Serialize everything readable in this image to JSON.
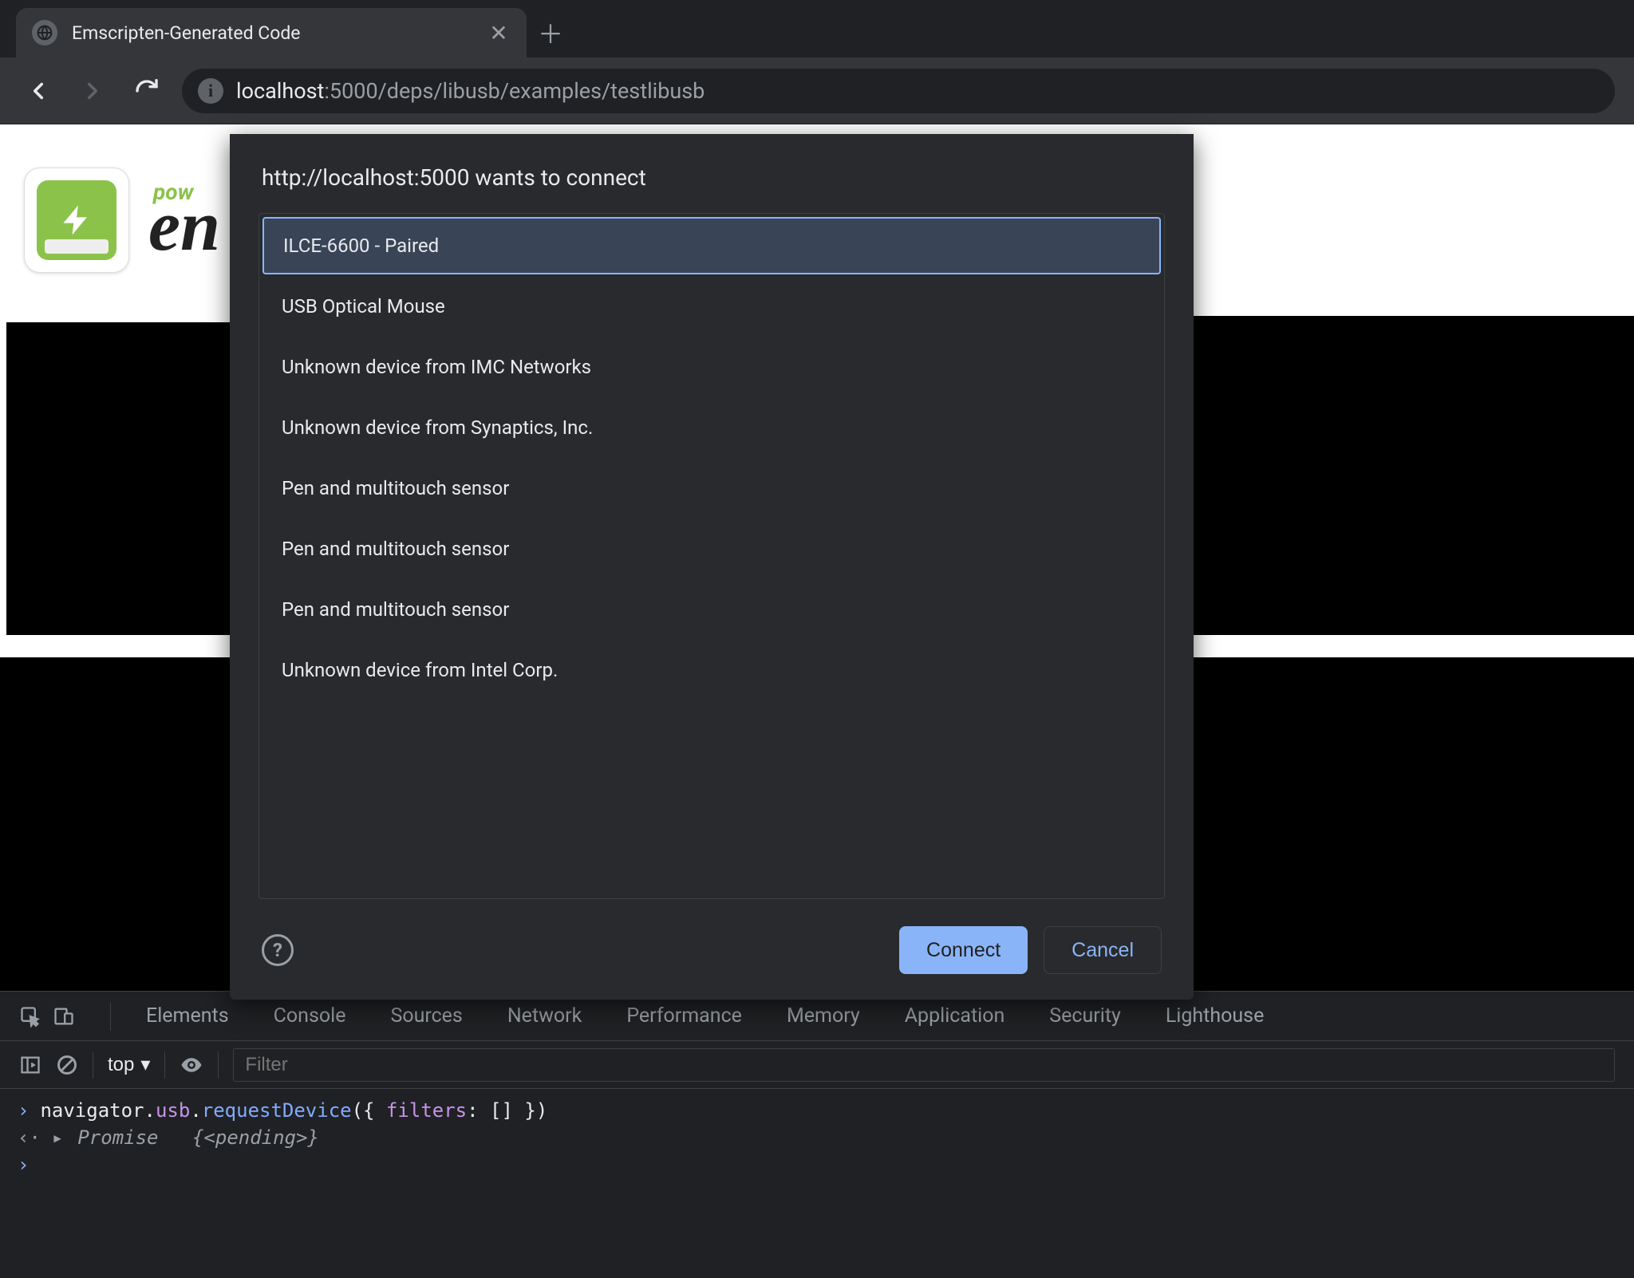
{
  "browser": {
    "tab_title": "Emscripten-Generated Code",
    "url_host": "localhost",
    "url_path": ":5000/deps/libusb/examples/testlibusb"
  },
  "page": {
    "sup": "pow",
    "logo_text": "en"
  },
  "dialog": {
    "title": "http://localhost:5000 wants to connect",
    "devices": [
      "ILCE-6600 - Paired",
      "USB Optical Mouse",
      "Unknown device from IMC Networks",
      "Unknown device from Synaptics, Inc.",
      "Pen and multitouch sensor",
      "Pen and multitouch sensor",
      "Pen and multitouch sensor",
      "Unknown device from Intel Corp."
    ],
    "selected_index": 0,
    "connect_label": "Connect",
    "cancel_label": "Cancel"
  },
  "devtools": {
    "tabs": [
      "Elements",
      "Console",
      "Sources",
      "Network",
      "Performance",
      "Memory",
      "Application",
      "Security",
      "Lighthouse"
    ],
    "context": "top",
    "filter_placeholder": "Filter",
    "lines": {
      "input": "navigator.usb.requestDevice({ filters: [] })",
      "result_prefix": "Promise",
      "result_body": "{<pending>}"
    }
  }
}
